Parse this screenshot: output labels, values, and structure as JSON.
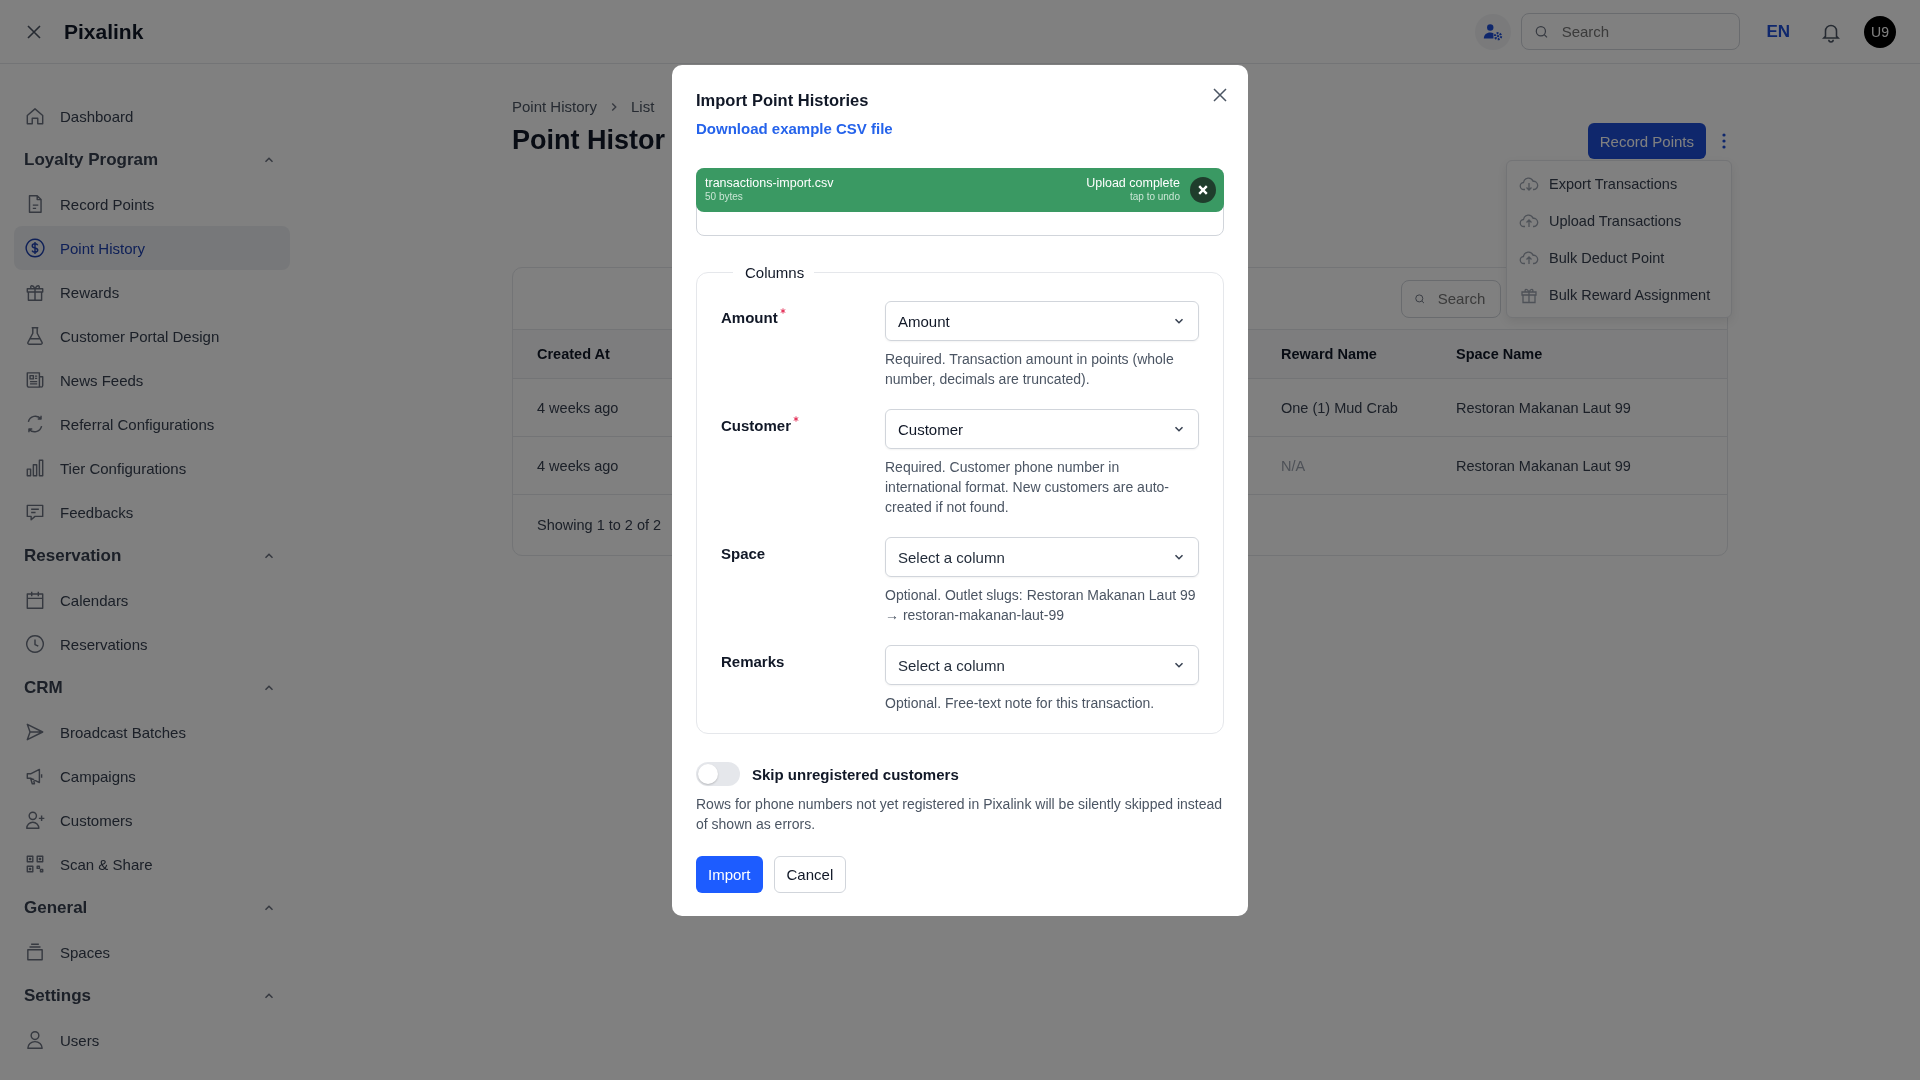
{
  "app": {
    "title": "Pixalink"
  },
  "top_bar": {
    "search": {
      "placeholder": "Search"
    },
    "language": "EN",
    "avatar": "U9"
  },
  "sidebar": {
    "items": [
      {
        "label": "Dashboard",
        "selected": false
      }
    ],
    "sections": [
      {
        "title": "Loyalty Program",
        "expanded": true,
        "items": [
          {
            "label": "Record Points",
            "selected": false
          },
          {
            "label": "Point History",
            "selected": true
          },
          {
            "label": "Rewards",
            "selected": false
          },
          {
            "label": "Customer Portal Design",
            "selected": false
          },
          {
            "label": "News Feeds",
            "selected": false
          },
          {
            "label": "Referral Configurations",
            "selected": false
          },
          {
            "label": "Tier Configurations",
            "selected": false
          },
          {
            "label": "Feedbacks",
            "selected": false
          }
        ]
      },
      {
        "title": "Reservation",
        "expanded": true,
        "items": [
          {
            "label": "Calendars",
            "selected": false
          },
          {
            "label": "Reservations",
            "selected": false
          }
        ]
      },
      {
        "title": "CRM",
        "expanded": true,
        "items": [
          {
            "label": "Broadcast Batches",
            "selected": false
          },
          {
            "label": "Campaigns",
            "selected": false
          },
          {
            "label": "Customers",
            "selected": false
          },
          {
            "label": "Scan & Share",
            "selected": false
          }
        ]
      },
      {
        "title": "General",
        "expanded": true,
        "items": [
          {
            "label": "Spaces",
            "selected": false
          }
        ]
      },
      {
        "title": "Settings",
        "expanded": true,
        "items": [
          {
            "label": "Users",
            "selected": false
          }
        ]
      }
    ]
  },
  "page": {
    "breadcrumb": [
      "Point History",
      "List"
    ],
    "title": "Point Histor",
    "primary_action": "Record Points",
    "menu": [
      "Export Transactions",
      "Upload Transactions",
      "Bulk Deduct Point",
      "Bulk Reward Assignment"
    ],
    "table": {
      "search": {
        "placeholder": "Search"
      },
      "columns": [
        "Created At",
        "Reward Name",
        "Space Name"
      ],
      "rows": [
        {
          "cells": [
            "4 weeks ago",
            "One (1) Mud Crab",
            "Restoran Makanan Laut 99"
          ],
          "reward_empty": false
        },
        {
          "cells": [
            "4 weeks ago",
            "N/A",
            "Restoran Makanan Laut 99"
          ],
          "reward_empty": true
        }
      ],
      "footer": "Showing 1 to 2 of 2"
    }
  },
  "dialog": {
    "title": "Import Point Histories",
    "link": "Download example CSV file",
    "upload": {
      "file_name": "transactions-import.csv",
      "size": "50 bytes",
      "status": "Upload complete",
      "hint": "tap to undo"
    },
    "legend": "Columns",
    "fields": [
      {
        "label": "Amount",
        "required": true,
        "value": "Amount",
        "help": "Required. Transaction amount in points (whole number, decimals are truncated)."
      },
      {
        "label": "Customer",
        "required": true,
        "value": "Customer",
        "help": "Required. Customer phone number in international format. New customers are auto-created if not found."
      },
      {
        "label": "Space",
        "required": false,
        "placeholder": "Select a column",
        "help": "Optional. Outlet slugs: Restoran Makanan Laut 99 → restoran-makanan-laut-99"
      },
      {
        "label": "Remarks",
        "required": false,
        "placeholder": "Select a column",
        "help": "Optional. Free-text note for this transaction."
      }
    ],
    "toggle": {
      "label": "Skip unregistered customers",
      "on": false,
      "help": "Rows for phone numbers not yet registered in Pixalink will be silently skipped instead of shown as errors."
    },
    "buttons": [
      {
        "label": "Import",
        "kind": "primary"
      },
      {
        "label": "Cancel",
        "kind": "secondary"
      }
    ]
  }
}
